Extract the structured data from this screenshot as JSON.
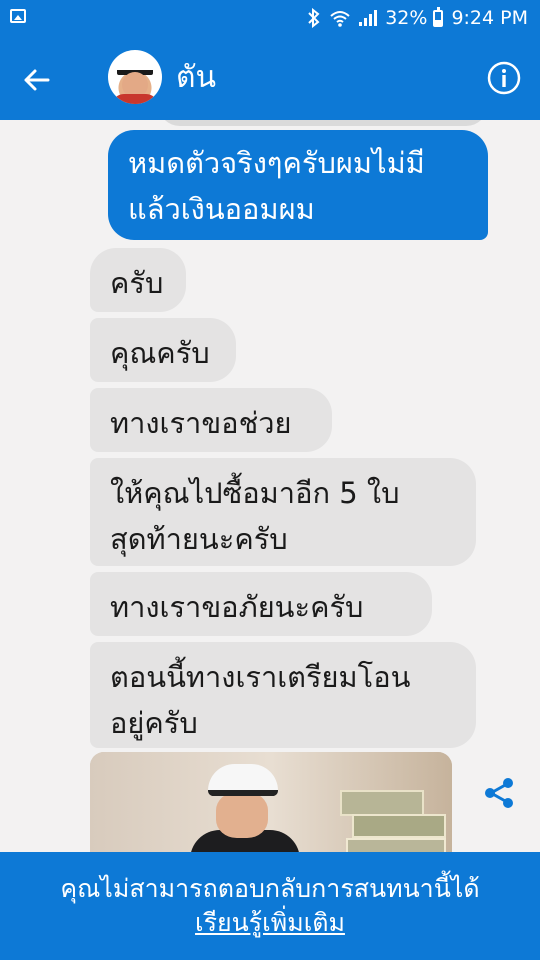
{
  "status_bar": {
    "battery_percent": "32%",
    "time": "9:24 PM",
    "icons": [
      "image-icon",
      "bluetooth-icon",
      "wifi-icon",
      "signal-icon",
      "battery-icon"
    ]
  },
  "header": {
    "contact_name": "ตัน",
    "back_icon": "arrow-left-icon",
    "info_icon": "info-icon"
  },
  "messages": [
    {
      "direction": "sent",
      "text": "หมดตัวจริงๆครับผมไม่มี\nแล้วเงินออมผม"
    },
    {
      "direction": "received",
      "text": "ครับ"
    },
    {
      "direction": "received",
      "text": "คุณครับ"
    },
    {
      "direction": "received",
      "text": "ทางเราขอช่วย"
    },
    {
      "direction": "received",
      "text": "ให้คุณไปซื้อมาอีก 5 ใบ\nสุดท้ายนะครับ"
    },
    {
      "direction": "received",
      "text": "ทางเราขอภัยนะครับ"
    },
    {
      "direction": "received",
      "text": "ตอนนี้ทางเราเตรียมโอน\nอยู่ครับ"
    }
  ],
  "share_icon": "share-icon",
  "footer": {
    "notice": "คุณไม่สามารถตอบกลับการสนทนานี้ได้",
    "learn_more": "เรียนรู้เพิ่มเติม"
  },
  "colors": {
    "brand_blue": "#0d79d6",
    "received_bubble": "#e4e3e3",
    "background": "#f3f2f2"
  }
}
